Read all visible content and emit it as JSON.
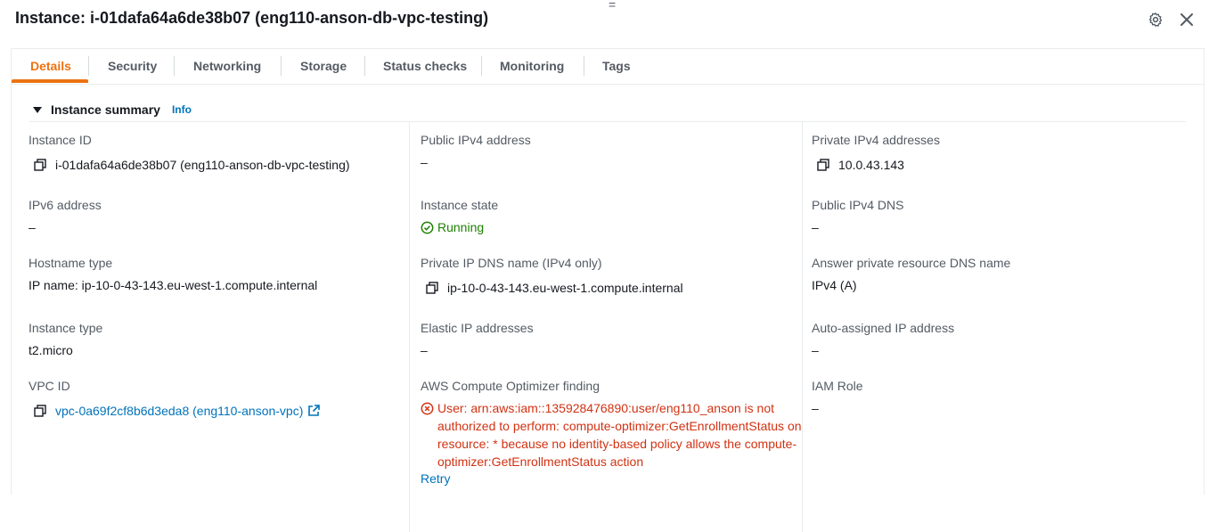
{
  "header": {
    "title": "Instance: i-01dafa64a6de38b07 (eng110-anson-db-vpc-testing)",
    "drag_glyph": "=",
    "settings_icon": "gear-icon",
    "close_icon": "close-icon"
  },
  "tabs": [
    {
      "label": "Details",
      "active": true
    },
    {
      "label": "Security"
    },
    {
      "label": "Networking"
    },
    {
      "label": "Storage"
    },
    {
      "label": "Status checks"
    },
    {
      "label": "Monitoring"
    },
    {
      "label": "Tags"
    }
  ],
  "section": {
    "title": "Instance summary",
    "info": "Info"
  },
  "fields": {
    "instance_id": {
      "label": "Instance ID",
      "value": "i-01dafa64a6de38b07 (eng110-anson-db-vpc-testing)"
    },
    "public_ipv4": {
      "label": "Public IPv4 address",
      "value": "–"
    },
    "private_ipv4": {
      "label": "Private IPv4 addresses",
      "value": "10.0.43.143"
    },
    "ipv6": {
      "label": "IPv6 address",
      "value": "–"
    },
    "instance_state": {
      "label": "Instance state",
      "value": "Running"
    },
    "public_dns": {
      "label": "Public IPv4 DNS",
      "value": "–"
    },
    "hostname_type": {
      "label": "Hostname type",
      "value": "IP name: ip-10-0-43-143.eu-west-1.compute.internal"
    },
    "private_dns": {
      "label": "Private IP DNS name (IPv4 only)",
      "value": "ip-10-0-43-143.eu-west-1.compute.internal"
    },
    "answer_dns": {
      "label": "Answer private resource DNS name",
      "value": "IPv4 (A)"
    },
    "instance_type": {
      "label": "Instance type",
      "value": "t2.micro"
    },
    "elastic_ip": {
      "label": "Elastic IP addresses",
      "value": "–"
    },
    "auto_ip": {
      "label": "Auto-assigned IP address",
      "value": "–"
    },
    "vpc_id": {
      "label": "VPC ID",
      "value": "vpc-0a69f2cf8b6d3eda8 (eng110-anson-vpc)"
    },
    "optimizer": {
      "label": "AWS Compute Optimizer finding",
      "error": "User: arn:aws:iam::135928476890:user/eng110_anson is not authorized to perform: compute-optimizer:GetEnrollmentStatus on resource: * because no identity-based policy allows the compute-optimizer:GetEnrollmentStatus action",
      "retry": "Retry"
    },
    "iam_role": {
      "label": "IAM Role",
      "value": "–"
    }
  },
  "colors": {
    "accent": "#ec7211",
    "link": "#0073bb",
    "success": "#1d8102",
    "error": "#d13212"
  }
}
